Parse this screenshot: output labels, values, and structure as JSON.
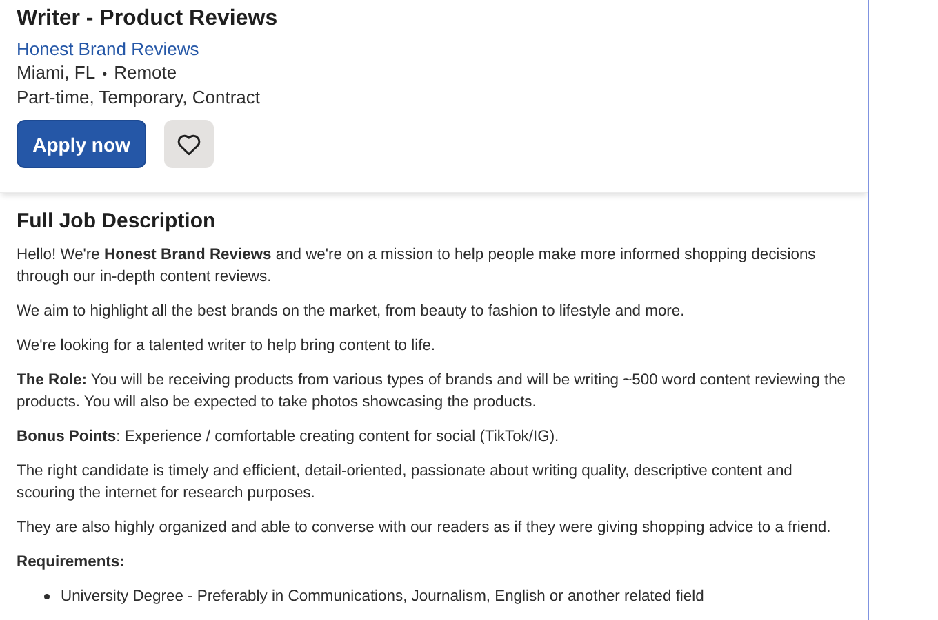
{
  "job": {
    "title": "Writer - Product Reviews",
    "company": "Honest Brand Reviews",
    "location": "Miami, FL",
    "separator": "•",
    "workplace": "Remote",
    "job_types": "Part-time, Temporary, Contract",
    "apply_button": "Apply now",
    "saved": false
  },
  "description": {
    "heading": "Full Job Description",
    "blocks": [
      {
        "kind": "paragraph",
        "text": "Hello! We're **Honest Brand Reviews** and we're on a mission to help people make more informed shopping decisions through our in-depth content reviews."
      },
      {
        "kind": "paragraph",
        "text": "We aim to highlight all the best brands on the market, from beauty to fashion to lifestyle and more."
      },
      {
        "kind": "paragraph",
        "text": "We're looking for a talented writer to help bring content to life."
      },
      {
        "kind": "paragraph",
        "text": "**The Role:** You will be receiving products from various types of brands and will be writing ~500 word content reviewing the products. You will also be expected to take photos showcasing the products."
      },
      {
        "kind": "paragraph",
        "text": "**Bonus Points**: Experience / comfortable creating content for social (TikTok/IG)."
      },
      {
        "kind": "paragraph",
        "text": "The right candidate is timely and efficient, detail-oriented, passionate about writing quality, descriptive content and scouring the internet for research purposes."
      },
      {
        "kind": "paragraph",
        "text": "They are also highly organized and able to converse with our readers as if they were giving shopping advice to a friend."
      },
      {
        "kind": "heading",
        "text": "Requirements:"
      },
      {
        "kind": "bullets",
        "items": [
          "University Degree - Preferably in Communications, Journalism, English or another related field"
        ]
      }
    ]
  }
}
